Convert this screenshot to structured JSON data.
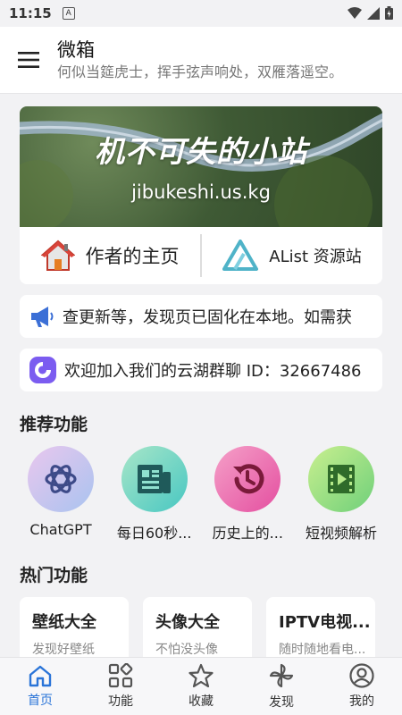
{
  "status": {
    "time": "11:15",
    "a_icon": "A"
  },
  "header": {
    "title": "微箱",
    "subtitle": "何似当筵虎士，挥手弦声响处，双雁落遥空。"
  },
  "banner": {
    "title": "机不可失的小站",
    "url": "jibukeshi.us.kg"
  },
  "links": [
    {
      "label": "作者的主页",
      "icon": "house-icon"
    },
    {
      "label": "AList 资源站",
      "icon": "alist-logo-icon"
    }
  ],
  "notices": [
    {
      "text": "查更新等，发现页已固化在本地。如需获",
      "icon": "megaphone-icon"
    },
    {
      "text": "欢迎加入我们的云湖群聊 ID：32667486",
      "icon": "yunhu-icon"
    }
  ],
  "recommended": {
    "title": "推荐功能",
    "items": [
      {
        "label": "ChatGPT",
        "icon": "openai-icon"
      },
      {
        "label": "每日60秒...",
        "icon": "news-icon"
      },
      {
        "label": "历史上的...",
        "icon": "history-icon"
      },
      {
        "label": "短视频解析",
        "icon": "video-icon"
      }
    ]
  },
  "hot": {
    "title": "热门功能",
    "items": [
      {
        "title": "壁纸大全",
        "desc": "发现好壁纸"
      },
      {
        "title": "头像大全",
        "desc": "不怕没头像"
      },
      {
        "title": "IPTV电视...",
        "desc": "随时随地看电..."
      }
    ]
  },
  "nav": [
    {
      "label": "首页",
      "icon": "home-icon",
      "active": true
    },
    {
      "label": "功能",
      "icon": "grid-icon",
      "active": false
    },
    {
      "label": "收藏",
      "icon": "star-icon",
      "active": false
    },
    {
      "label": "发现",
      "icon": "pinwheel-icon",
      "active": false
    },
    {
      "label": "我的",
      "icon": "person-icon",
      "active": false
    }
  ],
  "colors": {
    "accent": "#2a74d8",
    "background": "#f2f2f4"
  }
}
